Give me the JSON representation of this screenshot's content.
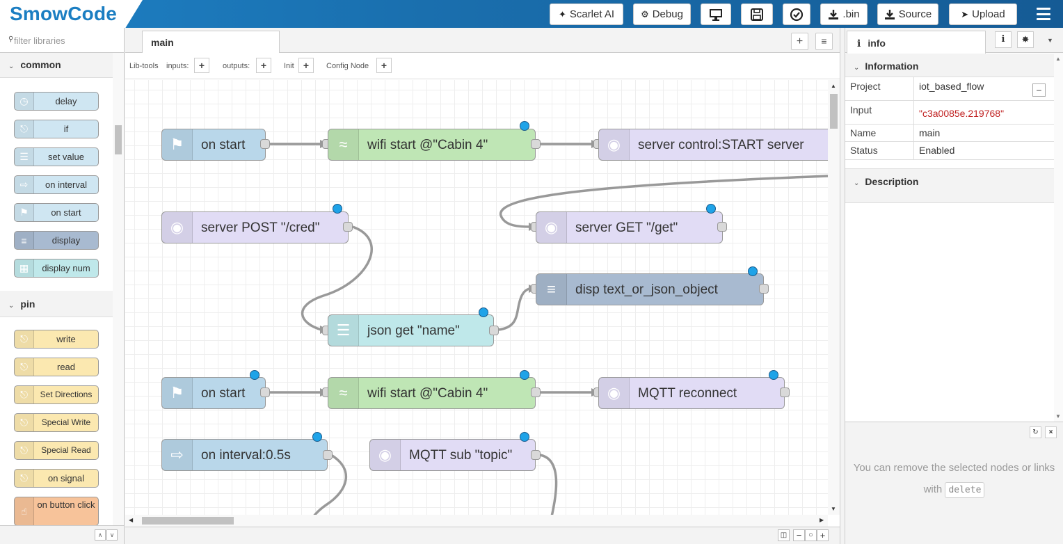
{
  "app": {
    "logo": "SmowCode"
  },
  "header": {
    "buttons": [
      {
        "label": "Scarlet AI",
        "icon": "magic-wand-icon"
      },
      {
        "label": "Debug",
        "icon": "gears-icon"
      },
      {
        "label": "",
        "icon": "monitor-icon"
      },
      {
        "label": "",
        "icon": "save-icon"
      },
      {
        "label": "",
        "icon": "check-circle-icon"
      },
      {
        "label": ".bin",
        "icon": "download-icon"
      },
      {
        "label": "Source",
        "icon": "download-icon"
      },
      {
        "label": "Upload",
        "icon": "rocket-icon"
      }
    ]
  },
  "palette": {
    "search_placeholder": "filter libraries",
    "categories": [
      {
        "name": "common",
        "nodes": [
          "delay",
          "if",
          "set value",
          "on interval",
          "on start",
          "display",
          "display num"
        ]
      },
      {
        "name": "pin",
        "nodes": [
          "write",
          "read",
          "Set Directions",
          "Special Write",
          "Special Read",
          "on signal",
          "on button click"
        ]
      }
    ]
  },
  "workspace": {
    "tab": "main",
    "libbar": {
      "lib_tools": "Lib-tools",
      "inputs": "inputs:",
      "outputs": "outputs:",
      "init": "Init",
      "config": "Config Node"
    },
    "nodes": [
      "on start",
      "wifi start @\"Cabin 4\"",
      "server control:START server",
      "server POST \"/cred\"",
      "server GET \"/get\"",
      "disp text_or_json_object",
      "json get \"name\"",
      "on start",
      "wifi start @\"Cabin 4\"",
      "MQTT reconnect",
      "on interval:0.5s",
      "MQTT sub \"topic\""
    ]
  },
  "sidebar": {
    "tab": "info",
    "info_section": "Information",
    "props": [
      {
        "key": "Project",
        "value": "iot_based_flow"
      },
      {
        "key": "Input",
        "value": "\"c3a0085e.219768\""
      },
      {
        "key": "Name",
        "value": "main"
      },
      {
        "key": "Status",
        "value": "Enabled"
      }
    ],
    "desc_section": "Description",
    "hint_text": "You can remove the selected nodes or links with",
    "hint_key": "delete"
  },
  "colors": {
    "header": "#1a6fae",
    "logo": "#1b7ec2",
    "flag_node": "#b9d7ea",
    "wifi_node": "#bfe6b5",
    "server_node": "#e1dcf5",
    "display_node": "#a8bad0",
    "json_node": "#bfe8ea",
    "pin_node": "#fbe8b0",
    "button_node": "#f7c39a",
    "dot": "#1fa3e8"
  }
}
